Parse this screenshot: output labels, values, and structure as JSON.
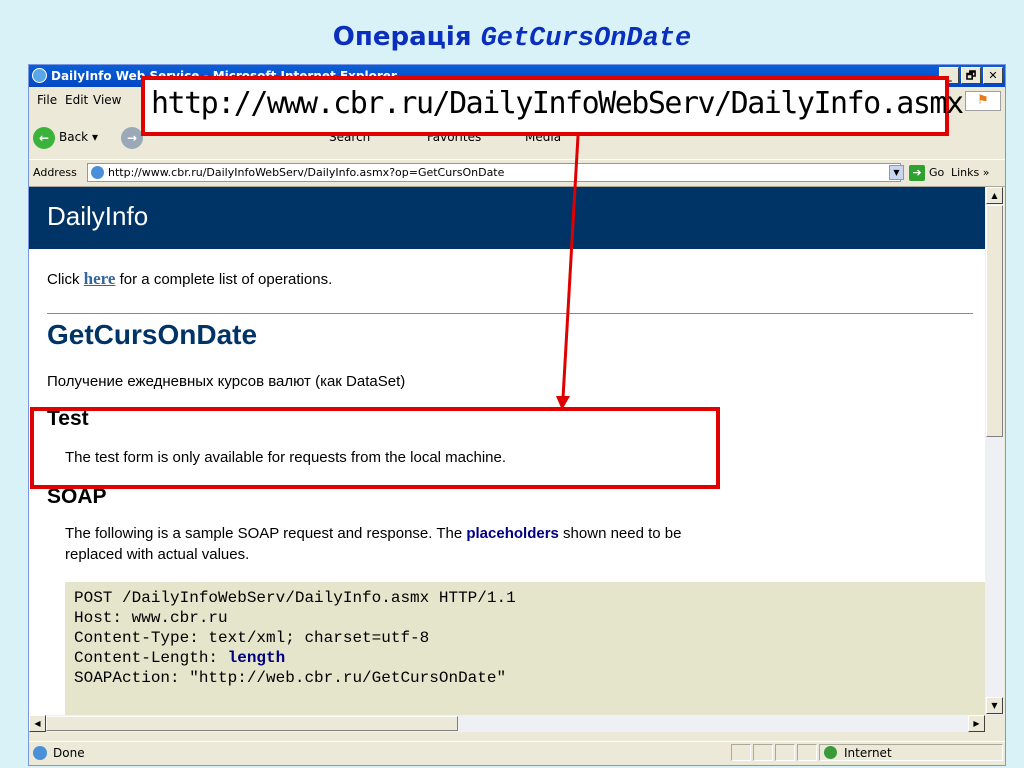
{
  "slide": {
    "title_prefix": "Операція ",
    "title_method": "GetCursOnDate"
  },
  "window": {
    "title": "DailyInfo Web Service - Microsoft Internet Explorer",
    "controls": [
      "_",
      "🗗",
      "✕"
    ]
  },
  "menu": {
    "file": "File",
    "edit": "Edit",
    "view": "View"
  },
  "toolbar": {
    "back_label": "Back",
    "search_label": "Search",
    "favorites_label": "Favorites",
    "media_label": "Media"
  },
  "address": {
    "label": "Address",
    "url": "http://www.cbr.ru/DailyInfoWebServ/DailyInfo.asmx?op=GetCursOnDate",
    "go_label": "Go",
    "links_label": "Links »"
  },
  "callout": {
    "url": "http://www.cbr.ru/DailyInfoWebServ/DailyInfo.asmx"
  },
  "page": {
    "header": "DailyInfo",
    "intro_before": "Click ",
    "intro_link": "here",
    "intro_after": " for a complete list of operations.",
    "operation_title": "GetCursOnDate",
    "operation_desc": "Получение ежедневных курсов валют (как DataSet)",
    "test_heading": "Test",
    "test_text": "The test form is only available for requests from the local machine.",
    "soap_heading": "SOAP",
    "soap_text_1": "The following is a sample SOAP request and response. The ",
    "soap_placeholders": "placeholders",
    "soap_text_2": " shown need to be",
    "soap_text_3": "replaced with actual values.",
    "code_line1": "POST /DailyInfoWebServ/DailyInfo.asmx HTTP/1.1",
    "code_line2": "Host: www.cbr.ru",
    "code_line3": "Content-Type: text/xml; charset=utf-8",
    "code_line4_key": "Content-Length: ",
    "code_line4_val": "length",
    "code_line5": "SOAPAction: \"http://web.cbr.ru/GetCursOnDate\""
  },
  "status": {
    "text": "Done",
    "zone": "Internet"
  },
  "colors": {
    "accent_red": "#e00000",
    "header_blue": "#003366",
    "slide_bg": "#d9f2f7"
  }
}
